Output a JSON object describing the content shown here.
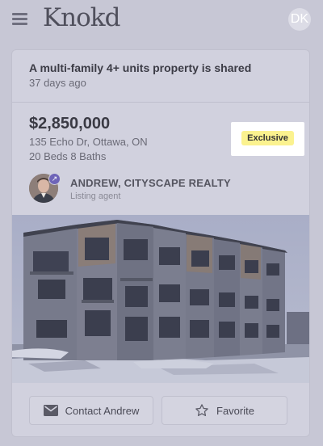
{
  "app": {
    "logo_text": "Knokd",
    "user_initials": "DK"
  },
  "listing": {
    "headline": "A multi-family 4+ units property is shared",
    "age": "37 days ago",
    "price": "$2,850,000",
    "address": "135 Echo Dr, Ottawa, ON",
    "beds_baths": "20 Beds 8 Baths",
    "badge": "Exclusive",
    "agent": {
      "name": "ANDREW, CITYSCAPE REALTY",
      "role": "Listing agent"
    }
  },
  "actions": {
    "contact_label": "Contact Andrew",
    "favorite_label": "Favorite"
  },
  "icons": {
    "menu": "hamburger-icon",
    "contact": "mail-icon",
    "favorite": "star-outline-icon",
    "agent_badge": "share-arrow-icon"
  },
  "colors": {
    "badge_bg": "#fbf28f",
    "overlay": "#c7c7d5"
  }
}
